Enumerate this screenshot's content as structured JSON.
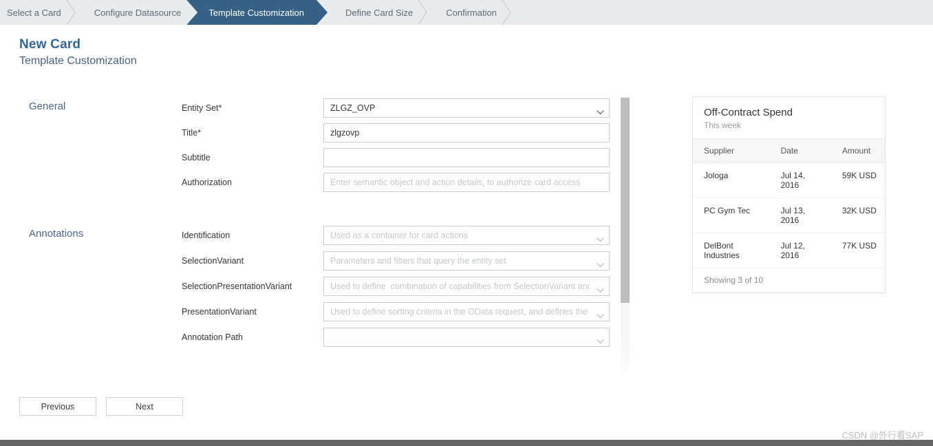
{
  "wizard": {
    "steps": [
      {
        "label": "Select a Card",
        "active": false
      },
      {
        "label": "Configure Datasource",
        "active": false
      },
      {
        "label": "Template Customization",
        "active": true
      },
      {
        "label": "Define Card Size",
        "active": false
      },
      {
        "label": "Confirmation",
        "active": false
      }
    ],
    "active_color": "#356185",
    "bar_color": "#e7ebee"
  },
  "header": {
    "title": "New Card",
    "subtitle": "Template Customization",
    "title_color": "#346694"
  },
  "form": {
    "groups": [
      {
        "title": "General"
      },
      {
        "title": "Annotations"
      }
    ],
    "general": {
      "entity_set": {
        "label": "Entity Set*",
        "value": "ZLGZ_OVP",
        "placeholder": "",
        "icon": "chevron-down-icon"
      },
      "title": {
        "label": "Title*",
        "value": "zlgzovp",
        "placeholder": ""
      },
      "subtitle": {
        "label": "Subtitle",
        "value": "",
        "placeholder": ""
      },
      "authorization": {
        "label": "Authorization",
        "value": "",
        "placeholder": "Enter semantic object and action details, to authorize card access"
      }
    },
    "annotations": {
      "identification": {
        "label": "Identification",
        "value": "",
        "placeholder": "Used as a container for card actions",
        "icon": "chevron-down-icon"
      },
      "selection_variant": {
        "label": "SelectionVariant",
        "value": "",
        "placeholder": "Parameters and filters that query the entity set",
        "icon": "chevron-down-icon"
      },
      "selection_presentation_variant": {
        "label": "SelectionPresentationVariant",
        "value": "",
        "placeholder": "Used to define  combination of capabilities from SelectionVariant and",
        "icon": "chevron-down-icon"
      },
      "presentation_variant": {
        "label": "PresentationVariant",
        "value": "",
        "placeholder": "Used to define sorting criteria in the OData request, and defines the w",
        "icon": "chevron-down-icon"
      },
      "annotation_path": {
        "label": "Annotation Path",
        "value": "",
        "placeholder": "",
        "icon": "chevron-down-icon"
      }
    }
  },
  "preview_card": {
    "title": "Off-Contract Spend",
    "subtitle": "This week",
    "columns": [
      "Supplier",
      "Date",
      "Amount"
    ],
    "rows": [
      {
        "supplier": "Jologa",
        "date": "Jul 14, 2016",
        "amount": "59K USD"
      },
      {
        "supplier": "PC Gym Tec",
        "date": "Jul 13, 2016",
        "amount": "32K USD"
      },
      {
        "supplier": "DelBont Industries",
        "date": "Jul 12, 2016",
        "amount": "77K USD"
      }
    ],
    "footer": "Showing 3 of 10"
  },
  "footer": {
    "previous_label": "Previous",
    "next_label": "Next"
  },
  "watermark": "CSDN @外行看SAP"
}
